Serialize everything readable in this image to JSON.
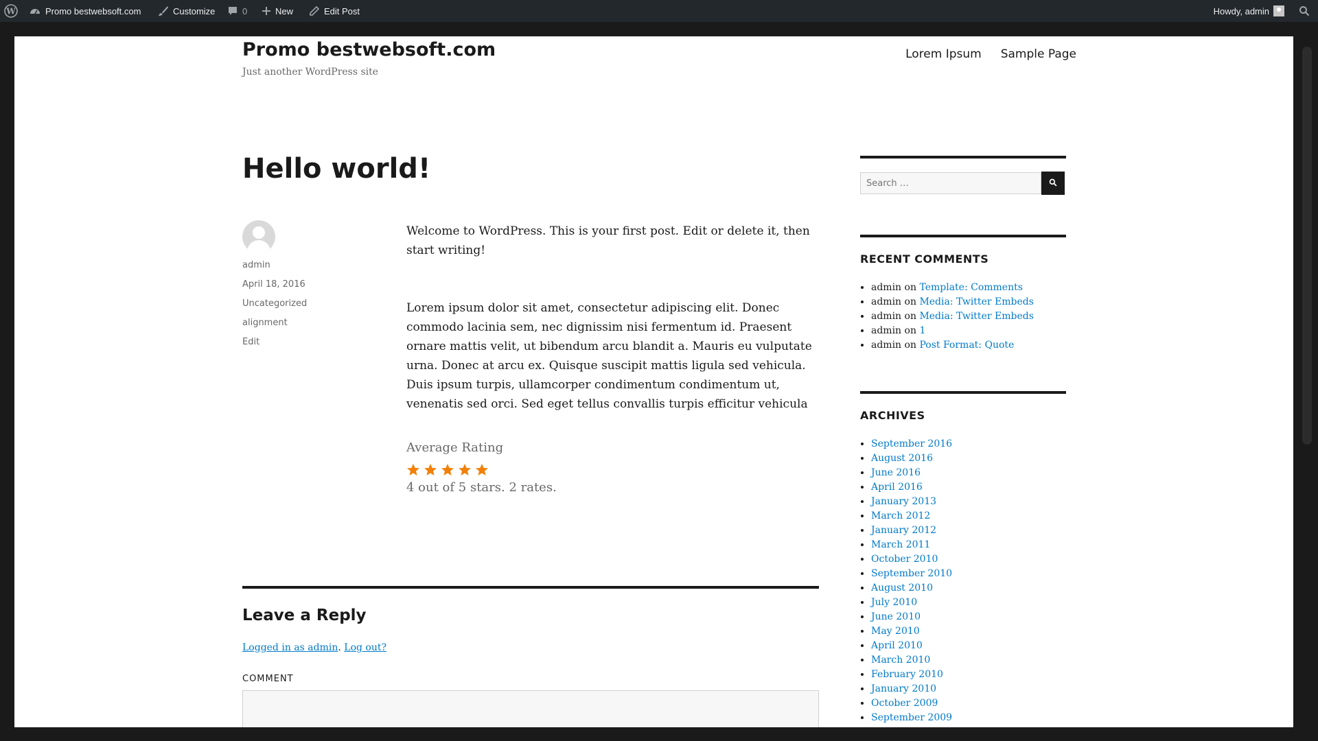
{
  "admin_bar": {
    "site_name": "Promo bestwebsoft.com",
    "customize": "Customize",
    "comments_count": "0",
    "new": "New",
    "edit_post": "Edit Post",
    "howdy": "Howdy, admin"
  },
  "header": {
    "site_title": "Promo bestwebsoft.com",
    "tagline": "Just another WordPress site",
    "nav": [
      "Lorem Ipsum",
      "Sample Page"
    ]
  },
  "post": {
    "title": "Hello world!",
    "author": "admin",
    "date": "April 18, 2016",
    "category": "Uncategorized",
    "tag": "alignment",
    "edit": "Edit",
    "paragraph1": "Welcome to WordPress. This is your first post. Edit or delete it, then start writing!",
    "paragraph2": "Lorem ipsum dolor sit amet, consectetur adipiscing elit. Donec commodo lacinia sem, nec dignissim nisi fermentum id. Praesent ornare mattis velit, ut bibendum arcu blandit a. Mauris eu vulputate urna. Donec at arcu ex. Quisque suscipit mattis ligula sed vehicula. Duis ipsum turpis, ullamcorper condimentum condimentum ut, venenatis sed orci. Sed eget tellus convallis turpis efficitur vehicula",
    "rating": {
      "title": "Average Rating",
      "stars_filled": 5,
      "stars_total": 5,
      "text": "4 out of 5 stars. 2 rates."
    }
  },
  "reply": {
    "title": "Leave a Reply",
    "logged_in": "Logged in as admin",
    "logout": "Log out?",
    "comment_label": "COMMENT"
  },
  "sidebar": {
    "search_placeholder": "Search …",
    "recent_comments_title": "RECENT COMMENTS",
    "recent_comments": [
      {
        "author": "admin",
        "on": "on",
        "post": "Template: Comments"
      },
      {
        "author": "admin",
        "on": "on",
        "post": "Media: Twitter Embeds"
      },
      {
        "author": "admin",
        "on": "on",
        "post": "Media: Twitter Embeds"
      },
      {
        "author": "admin",
        "on": "on",
        "post": "1"
      },
      {
        "author": "admin",
        "on": "on",
        "post": "Post Format: Quote"
      }
    ],
    "archives_title": "ARCHIVES",
    "archives": [
      "September 2016",
      "August 2016",
      "June 2016",
      "April 2016",
      "January 2013",
      "March 2012",
      "January 2012",
      "March 2011",
      "October 2010",
      "September 2010",
      "August 2010",
      "July 2010",
      "June 2010",
      "May 2010",
      "April 2010",
      "March 2010",
      "February 2010",
      "January 2010",
      "October 2009",
      "September 2009"
    ]
  },
  "colors": {
    "link": "#007acc",
    "star": "#f28008",
    "admin_bar_bg": "#23282d"
  }
}
